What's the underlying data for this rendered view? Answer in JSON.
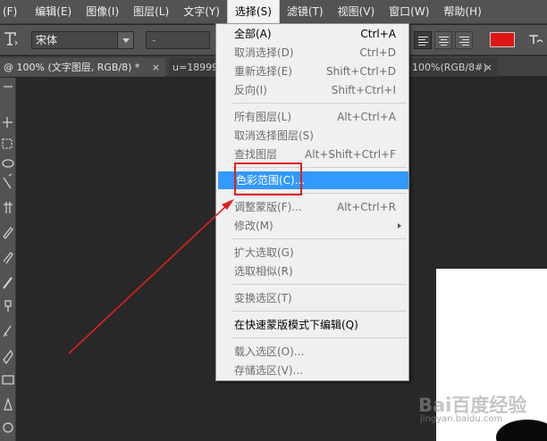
{
  "menubar": {
    "items": [
      {
        "label": "(F)"
      },
      {
        "label": "编辑(E)"
      },
      {
        "label": "图像(I)"
      },
      {
        "label": "图层(L)"
      },
      {
        "label": "文字(Y)"
      },
      {
        "label": "选择(S)"
      },
      {
        "label": "滤镜(T)"
      },
      {
        "label": "视图(V)"
      },
      {
        "label": "窗口(W)"
      },
      {
        "label": "帮助(H)"
      }
    ]
  },
  "options": {
    "tool_icon": "text-tool-icon",
    "font_family": "宋体",
    "font_style": "-",
    "text_color": "#e01515"
  },
  "tabs": [
    {
      "label": "@ 100% (文字图层, RGB/8) *",
      "close": "×"
    },
    {
      "label": "u=18999",
      "close": ""
    },
    {
      "label": "100%(RGB/8#)",
      "close": "×"
    }
  ],
  "select_menu": {
    "items": [
      {
        "label": "全部(A)",
        "shortcut": "Ctrl+A",
        "enabled": true
      },
      {
        "label": "取消选择(D)",
        "shortcut": "Ctrl+D",
        "enabled": false
      },
      {
        "label": "重新选择(E)",
        "shortcut": "Shift+Ctrl+D",
        "enabled": false
      },
      {
        "label": "反向(I)",
        "shortcut": "Shift+Ctrl+I",
        "enabled": false
      },
      {
        "label": "所有图层(L)",
        "shortcut": "Alt+Ctrl+A",
        "enabled": false
      },
      {
        "label": "取消选择图层(S)",
        "shortcut": "",
        "enabled": false
      },
      {
        "label": "查找图层",
        "shortcut": "Alt+Shift+Ctrl+F",
        "enabled": false
      },
      {
        "label": "色彩范围(C)...",
        "shortcut": "",
        "enabled": true,
        "highlighted": true
      },
      {
        "label": "调整蒙版(F)...",
        "shortcut": "Alt+Ctrl+R",
        "enabled": false
      },
      {
        "label": "修改(M)",
        "shortcut": "",
        "enabled": false,
        "submenu": true
      },
      {
        "label": "扩大选取(G)",
        "shortcut": "",
        "enabled": false
      },
      {
        "label": "选取相似(R)",
        "shortcut": "",
        "enabled": false
      },
      {
        "label": "变换选区(T)",
        "shortcut": "",
        "enabled": false
      },
      {
        "label": "在快速蒙版模式下编辑(Q)",
        "shortcut": "",
        "enabled": true
      },
      {
        "label": "载入选区(O)...",
        "shortcut": "",
        "enabled": false
      },
      {
        "label": "存储选区(V)...",
        "shortcut": "",
        "enabled": false
      }
    ]
  },
  "annotation": {
    "color": "#e02020"
  },
  "watermark": {
    "main": "Bai百度经验",
    "sub": "jingyan.baidu.com"
  }
}
